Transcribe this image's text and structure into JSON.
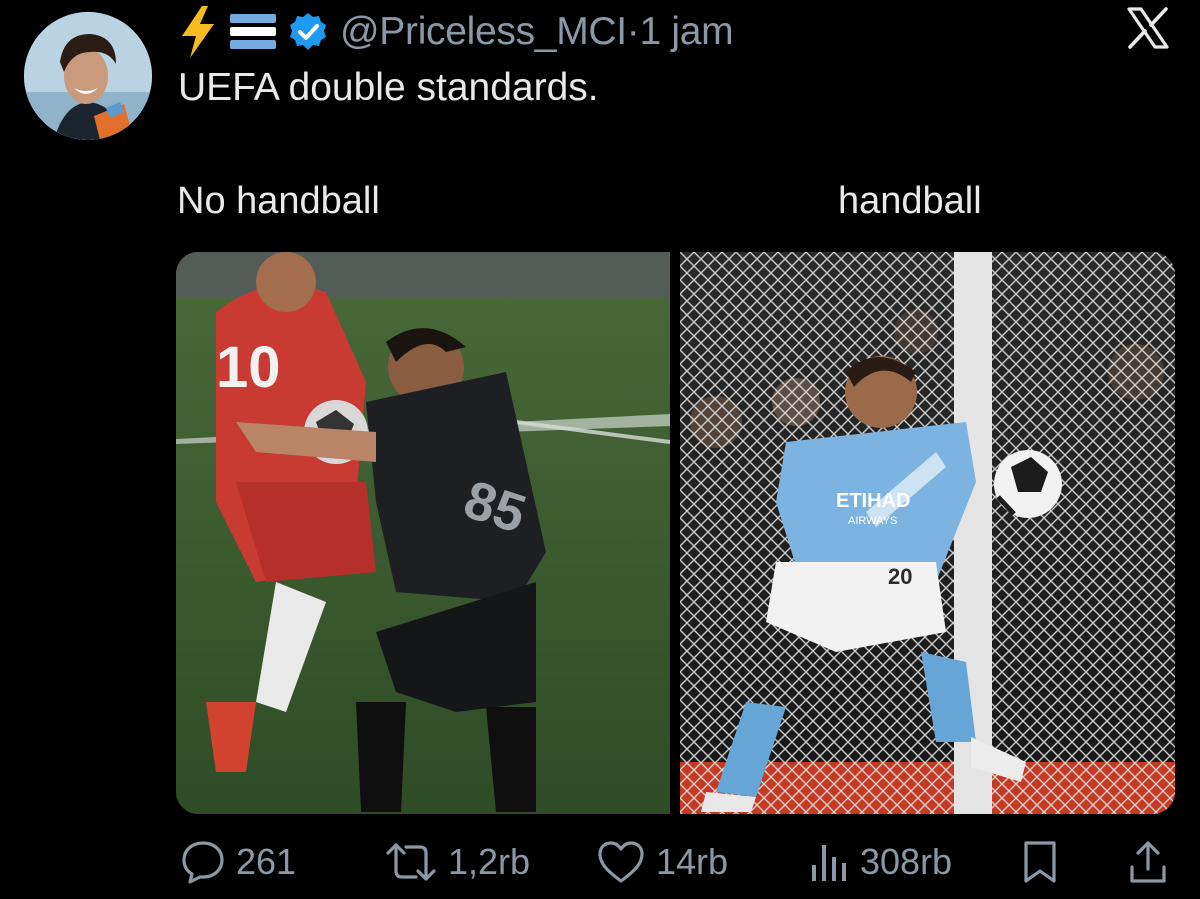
{
  "post": {
    "handle": "@Priceless_MCI",
    "separator": "·",
    "time": "1 jam",
    "text": "UEFA double standards.",
    "badges": [
      "lightning-icon",
      "argentina-flag-icon",
      "verified-badge-icon"
    ]
  },
  "media": {
    "left_caption": "No handball",
    "right_caption": "handball",
    "left_player_number": "10",
    "left_player_number_2": "85",
    "right_player_number": "20",
    "right_sponsor": "ETIHAD",
    "right_sponsor_sub": "AIRWAYS"
  },
  "actions": {
    "replies": "261",
    "reposts": "1,2rb",
    "likes": "14rb",
    "views": "308rb"
  },
  "colors": {
    "background": "#000000",
    "text": "#e7e9ea",
    "muted": "#8b98a5",
    "verified": "#1d9bf0"
  }
}
